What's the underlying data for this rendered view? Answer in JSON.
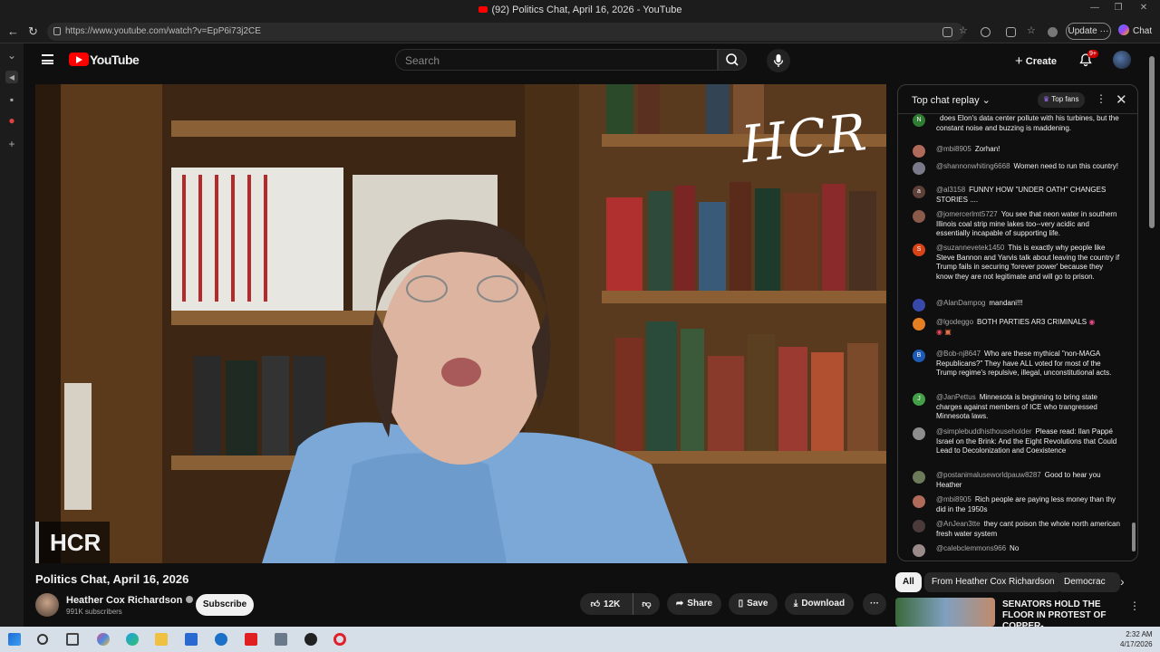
{
  "window": {
    "title": "(92) Politics Chat, April 16, 2026 - YouTube"
  },
  "browser": {
    "url": "https://www.youtube.com/watch?v=EpP6i73j2CE",
    "update_label": "Update",
    "chat_label": "Chat"
  },
  "header": {
    "logo_text": "YouTube",
    "search_placeholder": "Search",
    "create_label": "Create",
    "notif_count": "9+"
  },
  "video": {
    "watermark": "HCR",
    "lower_third": "HCR",
    "title": "Politics Chat, April 16, 2026"
  },
  "channel": {
    "name": "Heather Cox Richardson",
    "subscribers": "991K subscribers",
    "subscribe_label": "Subscribe"
  },
  "actions": {
    "likes": "12K",
    "share": "Share",
    "save": "Save",
    "download": "Download"
  },
  "chat": {
    "title": "Top chat replay",
    "top_fans": "Top fans",
    "messages": [
      {
        "author": "",
        "text": "does Elon's data center pollute with his turbines, but the constant noise and buzzing is maddening.",
        "avatar": "N",
        "color": "#2e7d32"
      },
      {
        "author": "@mbi8905",
        "text": "Zorhan!",
        "avatar": "",
        "color": "#b06a5a"
      },
      {
        "author": "@shannonwhiting6668",
        "text": "Women need to run this country!",
        "avatar": "",
        "color": "#7a7a8a"
      },
      {
        "author": "@al3158",
        "text": "FUNNY HOW \"UNDER OATH\" CHANGES STORIES ....",
        "avatar": "a",
        "color": "#5d4037"
      },
      {
        "author": "@jomercerlmt5727",
        "text": "You see that neon water in southern Illinois coal strip mine lakes too--very acidic and essentially incapable of supporting life.",
        "avatar": "",
        "color": "#8a5a4a"
      },
      {
        "author": "@suzannevetek1450",
        "text": "This is exactly why people like Steve Bannon and Yarvis talk about leaving the country if Trump fails in securing 'forever power' because they know they are not legitimate and will go to prison.",
        "avatar": "S",
        "color": "#d84315"
      },
      {
        "author": "@AlanDampog",
        "text": "mandani!!!",
        "avatar": "",
        "color": "#3949ab"
      },
      {
        "author": "@lgodeggo",
        "text": "BOTH PARTIES AR3 CRIMINALS",
        "avatar": "",
        "color": "#e67e22"
      },
      {
        "author": "@Bob-nj8647",
        "text": "Who are these mythical \"non-MAGA Republicans?\" They have ALL voted for most of the Trump regime's repulsive, illegal, unconstitutional acts.",
        "avatar": "B",
        "color": "#1e5bb5"
      },
      {
        "author": "@JanPettus",
        "text": "Minnesota is beginning to bring state charges against members of ICE who trangressed Minnesota laws.",
        "avatar": "J",
        "color": "#43a047"
      },
      {
        "author": "@simplebuddhisthouseholder",
        "text": "Please read: Ilan Pappé Israel on the Brink: And the Eight Revolutions that Could Lead to Decolonization and Coexistence",
        "avatar": "",
        "color": "#8d8d8d"
      },
      {
        "author": "@postanimaluseworldpauw8287",
        "text": "Good to hear you Heather",
        "avatar": "",
        "color": "#6d7a5a"
      },
      {
        "author": "@mbi8905",
        "text": "Rich people are paying less money than thy did in the 1950s",
        "avatar": "",
        "color": "#b06a5a"
      },
      {
        "author": "@AnJean3tte",
        "text": "they cant poison the whole north american fresh water system",
        "avatar": "",
        "color": "#4a3a3a"
      },
      {
        "author": "@calebclemmons966",
        "text": "No",
        "avatar": "",
        "color": "#9a8a8a"
      }
    ]
  },
  "chips": [
    "All",
    "From Heather Cox Richardson",
    "Democrac"
  ],
  "recommended": {
    "title": "SENATORS HOLD THE FLOOR IN PROTEST OF COPPER-..."
  },
  "clock": {
    "time": "2:32 AM",
    "date": "4/17/2026"
  }
}
